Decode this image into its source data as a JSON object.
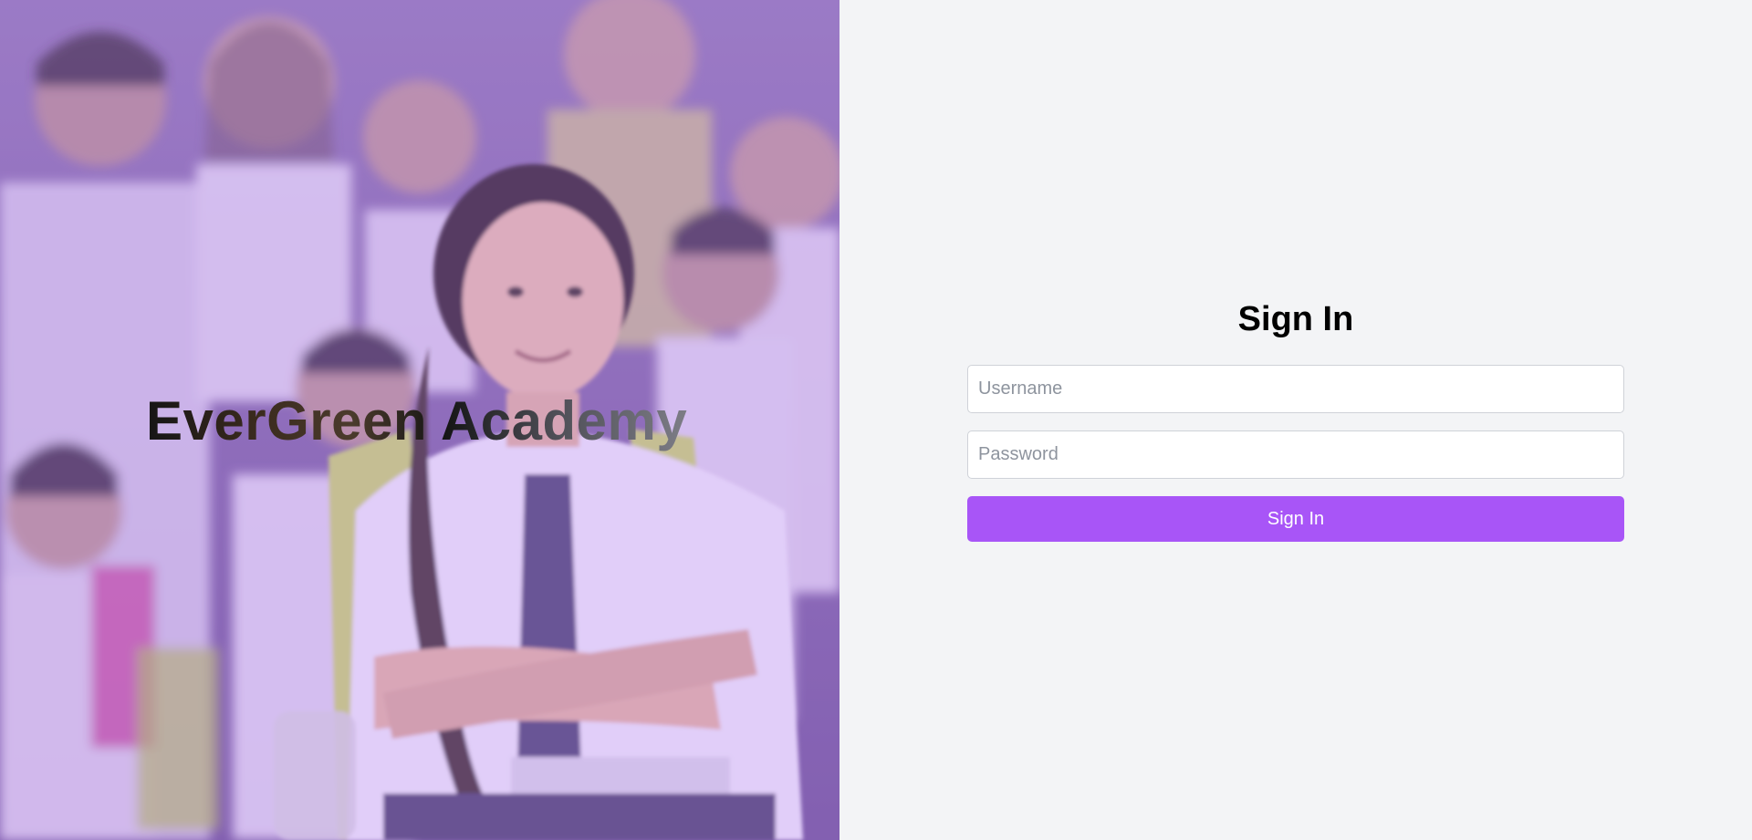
{
  "hero": {
    "brand_title": "EverGreen Academy",
    "image": "school-children-photo",
    "overlay_color": "#c08cff"
  },
  "auth": {
    "title": "Sign In",
    "username": {
      "placeholder": "Username",
      "value": ""
    },
    "password": {
      "placeholder": "Password",
      "value": ""
    },
    "submit_label": "Sign In"
  },
  "colors": {
    "accent": "#a855f7",
    "page_background": "#f3f4f6",
    "input_border": "#cfd2d8"
  }
}
